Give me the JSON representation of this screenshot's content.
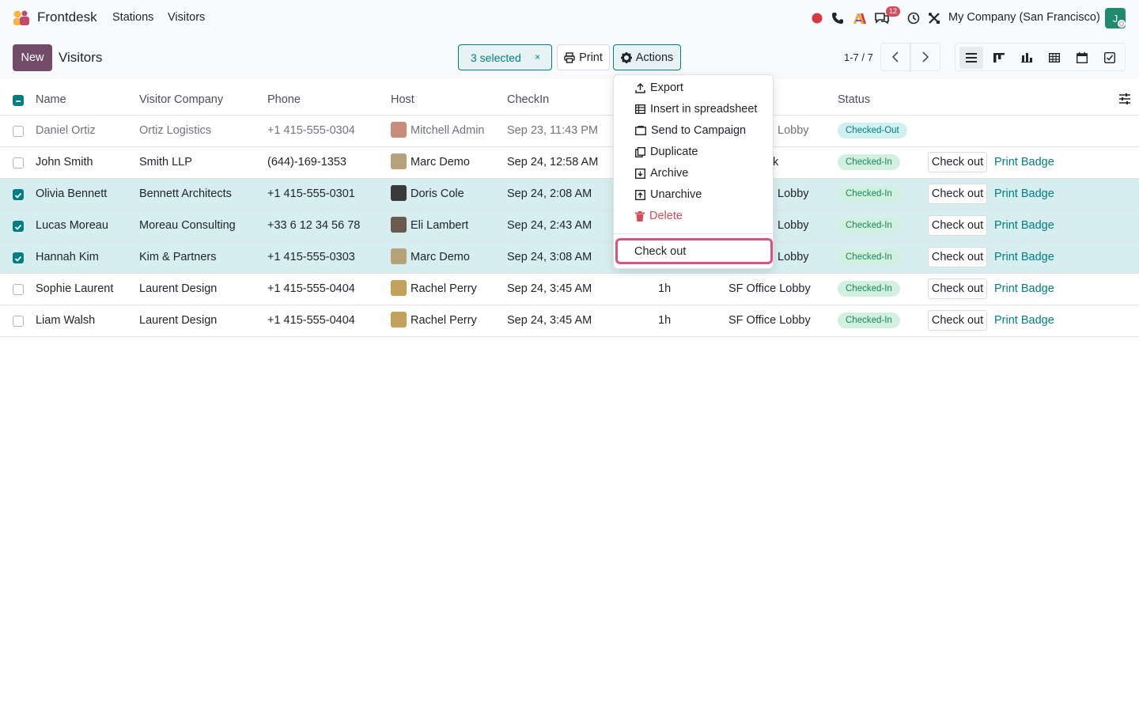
{
  "navbar": {
    "app_name": "Frontdesk",
    "menus": [
      "Stations",
      "Visitors"
    ],
    "message_count": "12",
    "company": "My Company (San Francisco)",
    "user_initial": "J"
  },
  "control_panel": {
    "new_label": "New",
    "title": "Visitors",
    "selected_label": "3 selected",
    "selected_clear": "×",
    "print_label": "Print",
    "actions_label": "Actions",
    "pager": "1-7 / 7"
  },
  "table": {
    "headers": [
      "Name",
      "Visitor Company",
      "Phone",
      "Host",
      "CheckIn",
      "Status"
    ],
    "rows": [
      {
        "name": "Daniel Ortiz",
        "company": "Ortiz Logistics",
        "phone": "+1 415-555-0304",
        "host": "Mitchell Admin",
        "checkin": "Sep 23, 11:43 PM",
        "duration": "",
        "station": "Lobby",
        "status": "Checked-Out",
        "checkout": "",
        "badge": ""
      },
      {
        "name": "John Smith",
        "company": "Smith LLP",
        "phone": "(644)-169-1353",
        "host": "Marc Demo",
        "checkin": "Sep 24, 12:58 AM",
        "duration": "",
        "station": "k",
        "status": "Checked-In",
        "checkout": "Check out",
        "badge": "Print Badge"
      },
      {
        "name": "Olivia Bennett",
        "company": "Bennett Architects",
        "phone": "+1 415-555-0301",
        "host": "Doris Cole",
        "checkin": "Sep 24, 2:08 AM",
        "duration": "",
        "station": "Lobby",
        "status": "Checked-In",
        "checkout": "Check out",
        "badge": "Print Badge"
      },
      {
        "name": "Lucas Moreau",
        "company": "Moreau Consulting",
        "phone": "+33 6 12 34 56 78",
        "host": "Eli Lambert",
        "checkin": "Sep 24, 2:43 AM",
        "duration": "",
        "station": "Lobby",
        "status": "Checked-In",
        "checkout": "Check out",
        "badge": "Print Badge"
      },
      {
        "name": "Hannah Kim",
        "company": "Kim & Partners",
        "phone": "+1 415-555-0303",
        "host": "Marc Demo",
        "checkin": "Sep 24, 3:08 AM",
        "duration": "",
        "station": "Lobby",
        "status": "Checked-In",
        "checkout": "Check out",
        "badge": "Print Badge"
      },
      {
        "name": "Sophie Laurent",
        "company": "Laurent Design",
        "phone": "+1 415-555-0404",
        "host": "Rachel Perry",
        "checkin": "Sep 24, 3:45 AM",
        "duration": "1h",
        "station": "SF Office Lobby",
        "status": "Checked-In",
        "checkout": "Check out",
        "badge": "Print Badge"
      },
      {
        "name": "Liam Walsh",
        "company": "Laurent Design",
        "phone": "+1 415-555-0404",
        "host": "Rachel Perry",
        "checkin": "Sep 24, 3:45 AM",
        "duration": "1h",
        "station": "SF Office Lobby",
        "status": "Checked-In",
        "checkout": "Check out",
        "badge": "Print Badge"
      }
    ]
  },
  "actions_menu": {
    "items": [
      "Export",
      "Insert in spreadsheet",
      "Send to Campaign",
      "Duplicate",
      "Archive",
      "Unarchive",
      "Delete"
    ],
    "checkout_label": "Check out"
  },
  "colors": {
    "brand": "#714b67",
    "accent": "#017e84",
    "selected_row": "#d7eef0",
    "danger": "#d44c59",
    "highlight": "#d8537f"
  }
}
